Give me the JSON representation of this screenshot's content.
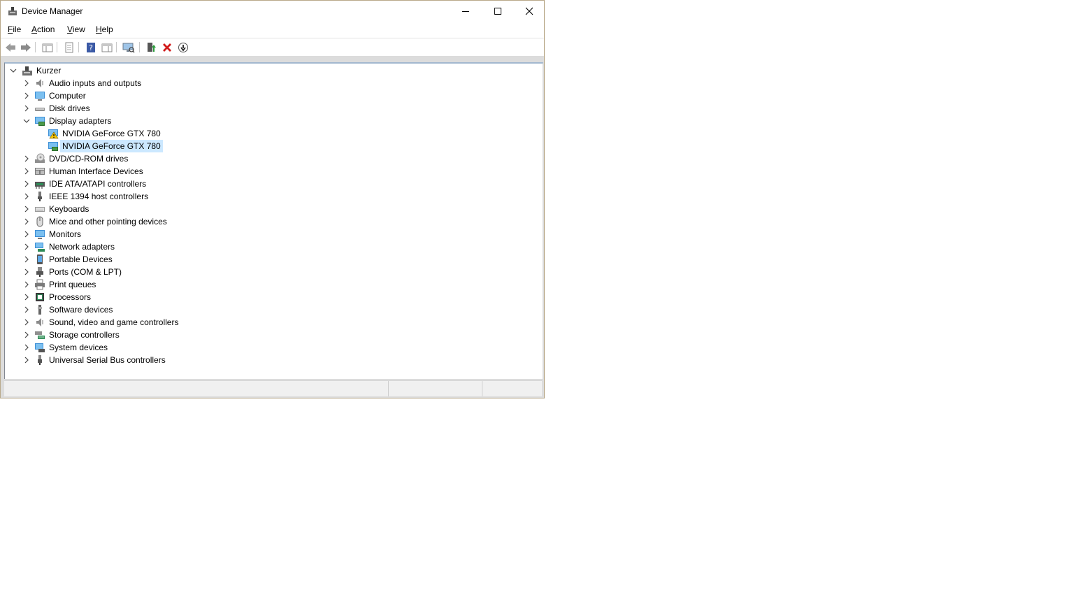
{
  "window": {
    "title": "Device Manager"
  },
  "menu": [
    {
      "label": "File",
      "access": "F",
      "rest": "ile"
    },
    {
      "label": "Action",
      "access": "A",
      "rest": "ction"
    },
    {
      "label": "View",
      "access": "V",
      "rest": "iew"
    },
    {
      "label": "Help",
      "access": "H",
      "rest": "elp"
    }
  ],
  "toolbar": {
    "buttons": [
      "back-arrow-icon",
      "forward-arrow-icon",
      "show-hide-console-tree-icon",
      "properties-icon",
      "help-icon",
      "action-pane-icon",
      "scan-hardware-icon",
      "update-driver-icon",
      "uninstall-device-icon",
      "enable-device-icon"
    ]
  },
  "tree": {
    "root": "Kurzer",
    "categories": [
      {
        "label": "Audio inputs and outputs",
        "icon": "speaker-icon"
      },
      {
        "label": "Computer",
        "icon": "computer-icon"
      },
      {
        "label": "Disk drives",
        "icon": "disk-drive-icon"
      },
      {
        "label": "Display adapters",
        "icon": "display-adapter-icon",
        "expanded": true,
        "children": [
          {
            "label": "NVIDIA GeForce GTX 780",
            "icon": "warning-display-adapter-icon"
          },
          {
            "label": "NVIDIA GeForce GTX 780",
            "icon": "display-adapter-icon",
            "selected": true
          }
        ]
      },
      {
        "label": "DVD/CD-ROM drives",
        "icon": "dvd-drive-icon"
      },
      {
        "label": "Human Interface Devices",
        "icon": "hid-icon"
      },
      {
        "label": "IDE ATA/ATAPI controllers",
        "icon": "ide-controller-icon"
      },
      {
        "label": "IEEE 1394 host controllers",
        "icon": "firewire-icon"
      },
      {
        "label": "Keyboards",
        "icon": "keyboard-icon"
      },
      {
        "label": "Mice and other pointing devices",
        "icon": "mouse-icon"
      },
      {
        "label": "Monitors",
        "icon": "monitor-icon"
      },
      {
        "label": "Network adapters",
        "icon": "network-adapter-icon"
      },
      {
        "label": "Portable Devices",
        "icon": "portable-device-icon"
      },
      {
        "label": "Ports (COM & LPT)",
        "icon": "port-icon"
      },
      {
        "label": "Print queues",
        "icon": "printer-icon"
      },
      {
        "label": "Processors",
        "icon": "processor-icon"
      },
      {
        "label": "Software devices",
        "icon": "software-device-icon"
      },
      {
        "label": "Sound, video and game controllers",
        "icon": "sound-controller-icon"
      },
      {
        "label": "Storage controllers",
        "icon": "storage-controller-icon"
      },
      {
        "label": "System devices",
        "icon": "system-device-icon"
      },
      {
        "label": "Universal Serial Bus controllers",
        "icon": "usb-icon"
      }
    ]
  },
  "colors": {
    "selection": "#cce8ff",
    "frame_border": "#b9a98a"
  }
}
